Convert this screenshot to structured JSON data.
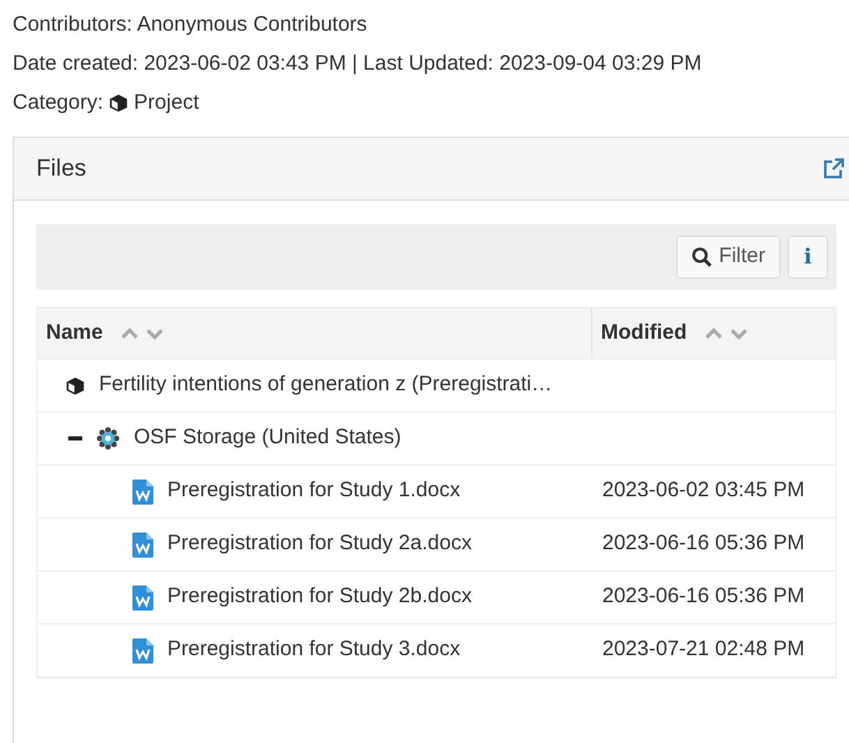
{
  "meta": {
    "contributors": "Contributors: Anonymous Contributors",
    "dates": "Date created: 2023-06-02 03:43 PM | Last Updated: 2023-09-04 03:29 PM",
    "category_label": "Category:",
    "category": "Project"
  },
  "panel": {
    "title": "Files",
    "toolbar": {
      "filter": "Filter",
      "info": "i"
    },
    "columns": [
      "Name",
      "Modified"
    ],
    "tree": [
      {
        "kind": "project",
        "name": "Fertility intentions of generation z (Preregistrati…",
        "children": [
          {
            "kind": "storage",
            "name": "OSF Storage (United States)",
            "expanded": true,
            "children": [
              {
                "kind": "file",
                "name": "Preregistration for Study 1.docx",
                "modified": "2023-06-02 03:45 PM"
              },
              {
                "kind": "file",
                "name": "Preregistration for Study 2a.docx",
                "modified": "2023-06-16 05:36 PM"
              },
              {
                "kind": "file",
                "name": "Preregistration for Study 2b.docx",
                "modified": "2023-06-16 05:36 PM"
              },
              {
                "kind": "file",
                "name": "Preregistration for Study 3.docx",
                "modified": "2023-07-21 02:48 PM"
              }
            ]
          }
        ]
      }
    ]
  }
}
